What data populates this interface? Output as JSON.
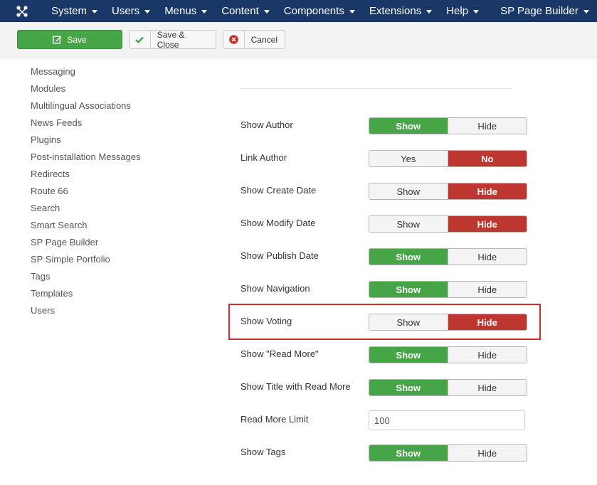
{
  "topnav": {
    "logo_icon": "joomla-logo-icon",
    "items": [
      {
        "label": "System"
      },
      {
        "label": "Users"
      },
      {
        "label": "Menus"
      },
      {
        "label": "Content"
      },
      {
        "label": "Components"
      },
      {
        "label": "Extensions"
      },
      {
        "label": "Help"
      },
      {
        "label": "SP Page Builder"
      }
    ]
  },
  "toolbar": {
    "save_label": "Save",
    "save_close_label": "Save & Close",
    "cancel_label": "Cancel"
  },
  "sidebar": {
    "items": [
      {
        "label": "Messaging"
      },
      {
        "label": "Modules"
      },
      {
        "label": "Multilingual Associations"
      },
      {
        "label": "News Feeds"
      },
      {
        "label": "Plugins"
      },
      {
        "label": "Post-installation Messages"
      },
      {
        "label": "Redirects"
      },
      {
        "label": "Route 66"
      },
      {
        "label": "Search"
      },
      {
        "label": "Smart Search"
      },
      {
        "label": "SP Page Builder"
      },
      {
        "label": "SP Simple Portfolio"
      },
      {
        "label": "Tags"
      },
      {
        "label": "Templates"
      },
      {
        "label": "Users"
      }
    ]
  },
  "settings": {
    "rows": [
      {
        "label": "Show Author",
        "left": "Show",
        "right": "Hide",
        "selected": "left"
      },
      {
        "label": "Link Author",
        "left": "Yes",
        "right": "No",
        "selected": "right"
      },
      {
        "label": "Show Create Date",
        "left": "Show",
        "right": "Hide",
        "selected": "right"
      },
      {
        "label": "Show Modify Date",
        "left": "Show",
        "right": "Hide",
        "selected": "right"
      },
      {
        "label": "Show Publish Date",
        "left": "Show",
        "right": "Hide",
        "selected": "left"
      },
      {
        "label": "Show Navigation",
        "left": "Show",
        "right": "Hide",
        "selected": "left"
      },
      {
        "label": "Show Voting",
        "left": "Show",
        "right": "Hide",
        "selected": "right"
      },
      {
        "label": "Show \"Read More\"",
        "left": "Show",
        "right": "Hide",
        "selected": "left"
      },
      {
        "label": "Show Title with Read More",
        "left": "Show",
        "right": "Hide",
        "selected": "left"
      }
    ],
    "read_more_limit": {
      "label": "Read More Limit",
      "value": "100"
    },
    "show_tags": {
      "label": "Show Tags",
      "left": "Show",
      "right": "Hide",
      "selected": "left"
    }
  },
  "colors": {
    "nav_bg": "#1a3867",
    "green": "#46a546",
    "red": "#bd362f",
    "highlight": "#c9302c"
  }
}
